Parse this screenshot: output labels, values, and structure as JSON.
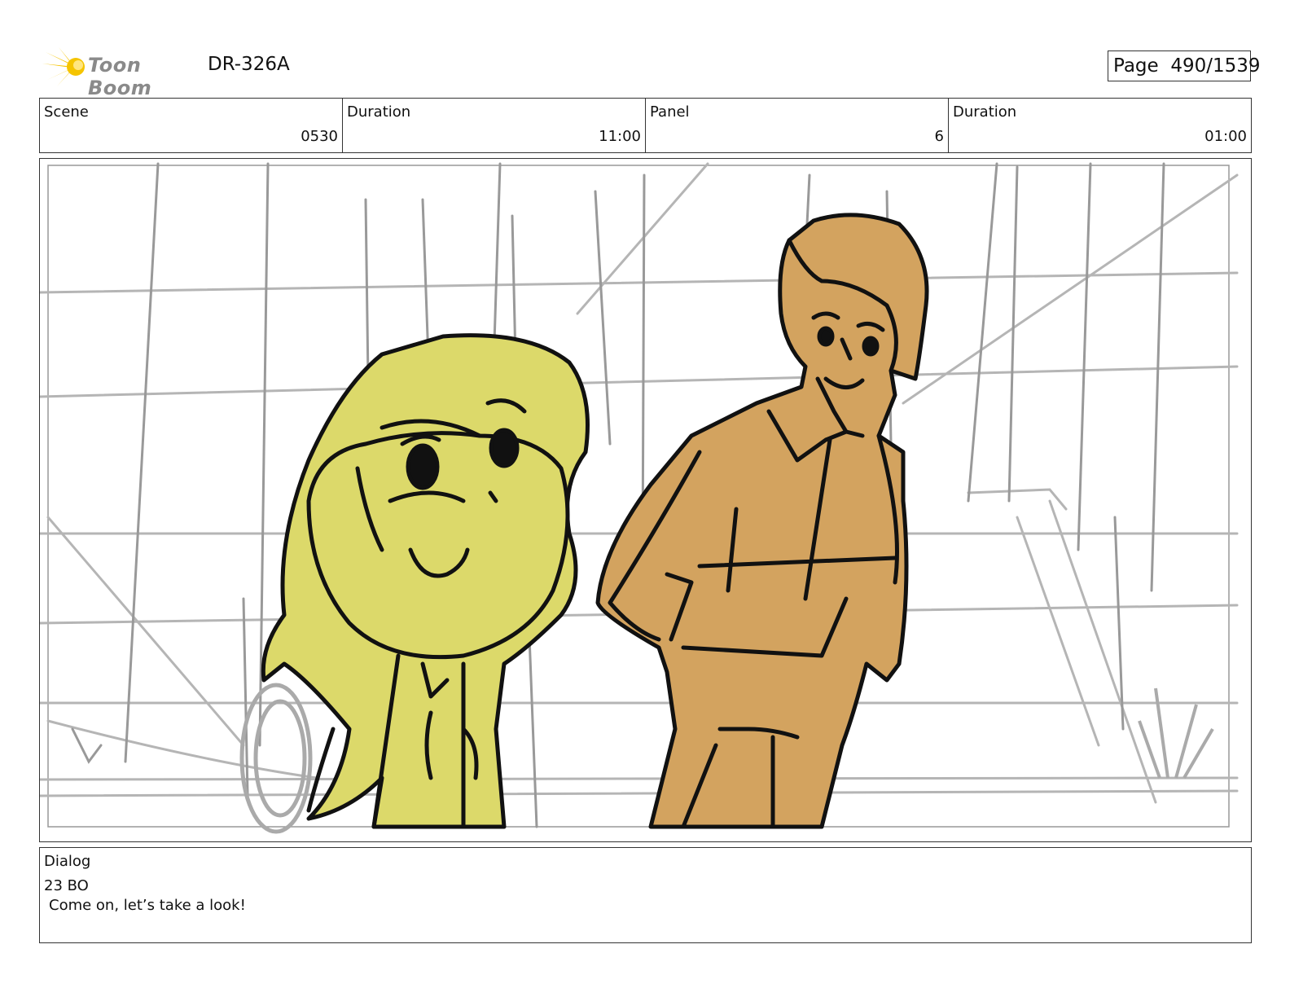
{
  "header": {
    "logo_text": "Toon Boom",
    "document_id": "DR-326A",
    "page_label": "Page",
    "page_number": "490/1539"
  },
  "info": {
    "scene_label": "Scene",
    "scene_value": "0530",
    "scene_duration_label": "Duration",
    "scene_duration_value": "11:00",
    "panel_label": "Panel",
    "panel_value": "6",
    "panel_duration_label": "Duration",
    "panel_duration_value": "01:00"
  },
  "dialog": {
    "label": "Dialog",
    "speaker": "23 BO",
    "line": "Come on, let’s take a look!"
  },
  "colors": {
    "girl_fill": "#dcd96a",
    "man_fill": "#d3a35f",
    "sketch_gray": "#a8a8a8",
    "logo_yellow": "#f5c400"
  }
}
